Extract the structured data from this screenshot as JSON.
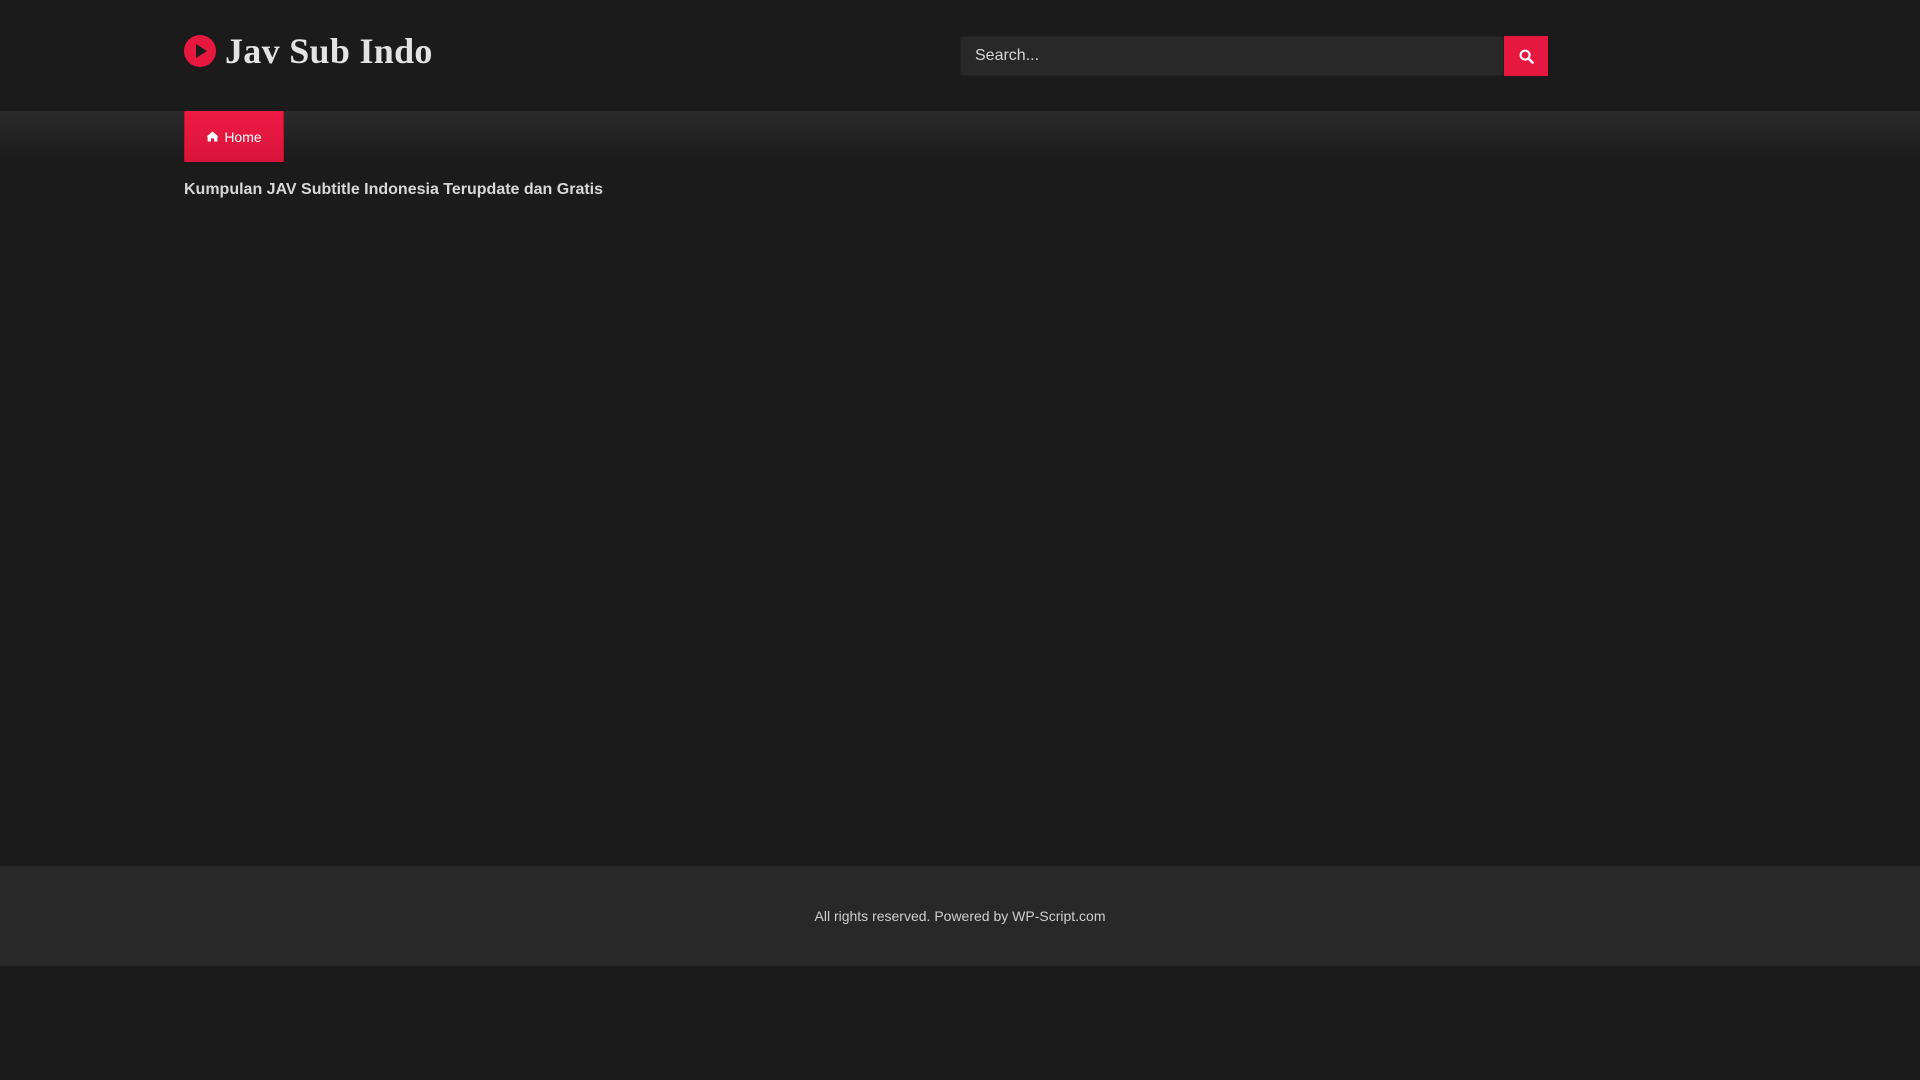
{
  "site": {
    "title": "Jav Sub Indo",
    "logo_icon": "play-circle-icon",
    "accent_color": "#e6183f",
    "background_color": "#1b1b1b"
  },
  "search": {
    "placeholder": "Search...",
    "value": "",
    "button_icon": "search-icon"
  },
  "nav": {
    "items": [
      {
        "label": "Home",
        "icon": "home-icon",
        "active": true
      }
    ]
  },
  "main": {
    "heading": "Kumpulan JAV Subtitle Indonesia Terupdate dan Gratis"
  },
  "footer": {
    "text": "All rights reserved. Powered by WP-Script.com"
  }
}
